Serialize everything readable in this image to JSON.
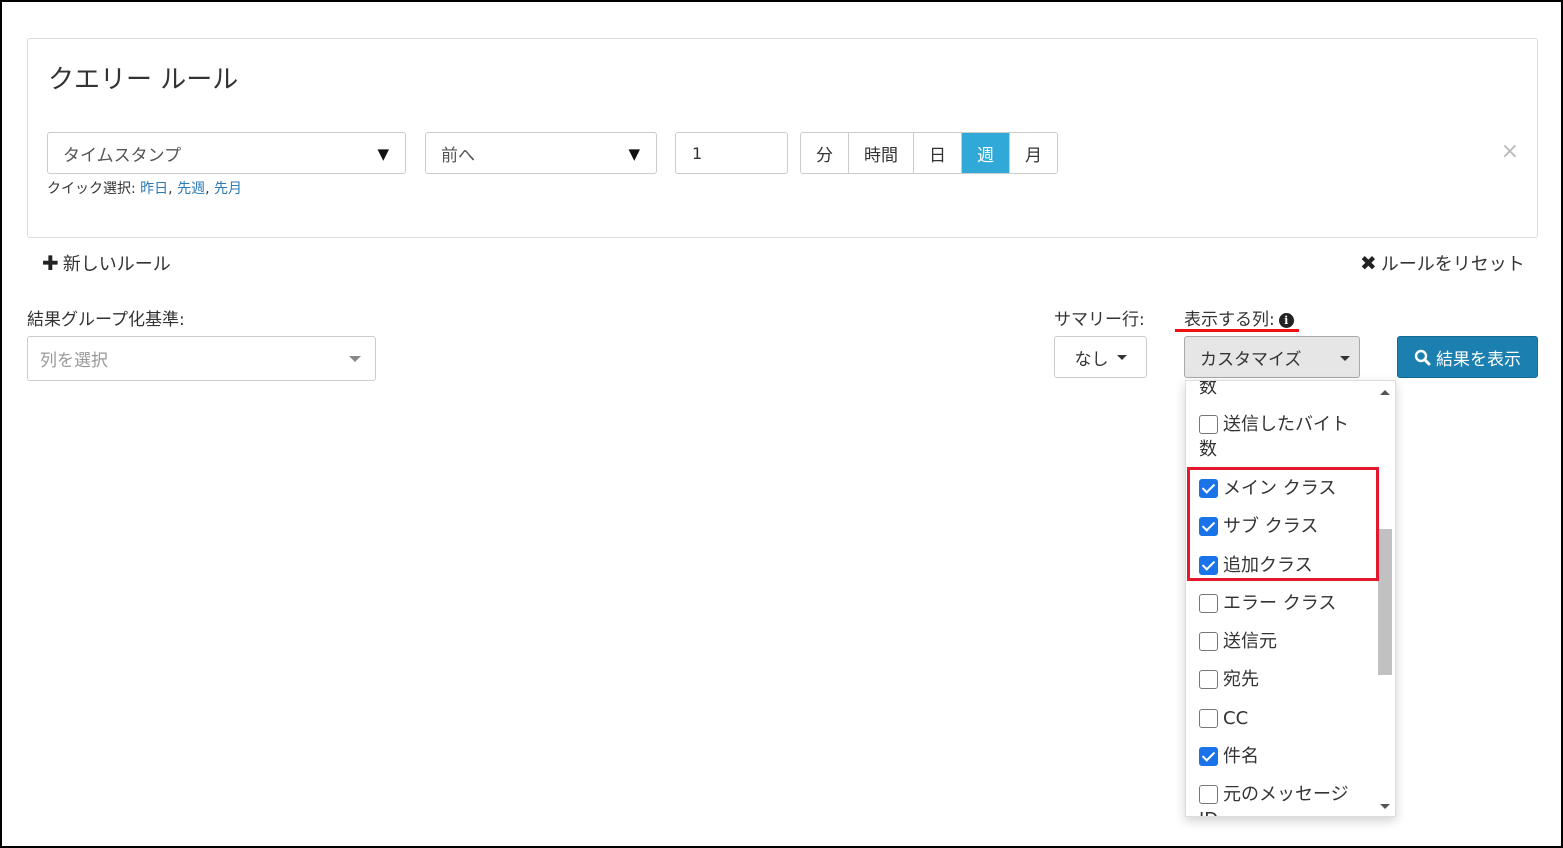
{
  "panel": {
    "title": "クエリー ルール",
    "field_select": "タイムスタンプ",
    "direction_select": "前へ",
    "amount": "1",
    "units": [
      "分",
      "時間",
      "日",
      "週",
      "月"
    ],
    "active_unit": "週",
    "quick_label": "クイック選択: ",
    "quick_links": [
      "昨日",
      "先週",
      "先月"
    ],
    "close_icon": "×"
  },
  "actions": {
    "new_rule": "新しいルール",
    "reset_rules": "ルールをリセット"
  },
  "group_by": {
    "label": "結果グループ化基準:",
    "placeholder": "列を選択"
  },
  "summary": {
    "label": "サマリー行:",
    "value": "なし"
  },
  "columns": {
    "label": "表示する列:",
    "button": "カスタマイズ",
    "items": [
      {
        "label": "数",
        "checked": null
      },
      {
        "label": "送信したバイト数",
        "checked": false
      },
      {
        "label": "メイン クラス",
        "checked": true
      },
      {
        "label": "サブ クラス",
        "checked": true
      },
      {
        "label": "追加クラス",
        "checked": true
      },
      {
        "label": "エラー クラス",
        "checked": false
      },
      {
        "label": "送信元",
        "checked": false
      },
      {
        "label": "宛先",
        "checked": false
      },
      {
        "label": "CC",
        "checked": false
      },
      {
        "label": "件名",
        "checked": true
      },
      {
        "label": "元のメッセージID",
        "checked": false
      }
    ]
  },
  "show_results": "結果を表示",
  "colors": {
    "active_unit": "#31a9d8",
    "primary_button": "#1b7fb0",
    "checkbox": "#1a73e8",
    "highlight": "#e3182d"
  }
}
